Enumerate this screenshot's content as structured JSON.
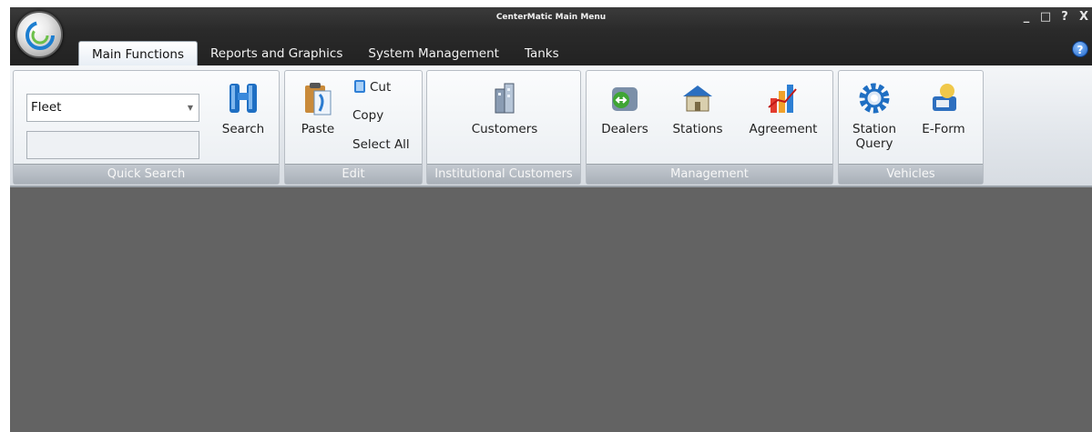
{
  "window": {
    "title": "CenterMatic Main Menu",
    "controls": [
      "_",
      "□",
      "?",
      "X"
    ]
  },
  "tabs": [
    "Main Functions",
    "Reports and Graphics",
    "System Management",
    "Tanks"
  ],
  "help": "?",
  "ribbon": {
    "quick_search": {
      "label": "Quick Search",
      "select_value": "Fleet",
      "input_value": "",
      "search_label": "Search"
    },
    "edit": {
      "label": "Edit",
      "paste": "Paste",
      "cut": "Cut",
      "copy": "Copy",
      "select_all": "Select All"
    },
    "institutional": {
      "label": "Institutional Customers",
      "customers": "Customers"
    },
    "management": {
      "label": "Management",
      "dealers": "Dealers",
      "stations": "Stations",
      "agreement": "Agreement"
    },
    "vehicles": {
      "label": "Vehicles",
      "station_query_line1": "Station",
      "station_query_line2": "Query",
      "eform": "E-Form"
    }
  },
  "icons": [
    "app-orb-icon",
    "help-icon",
    "binoculars-icon",
    "paste-icon",
    "cut-icon",
    "customers-icon",
    "dealers-icon",
    "stations-icon",
    "agreement-icon",
    "gear-icon",
    "eform-icon"
  ]
}
